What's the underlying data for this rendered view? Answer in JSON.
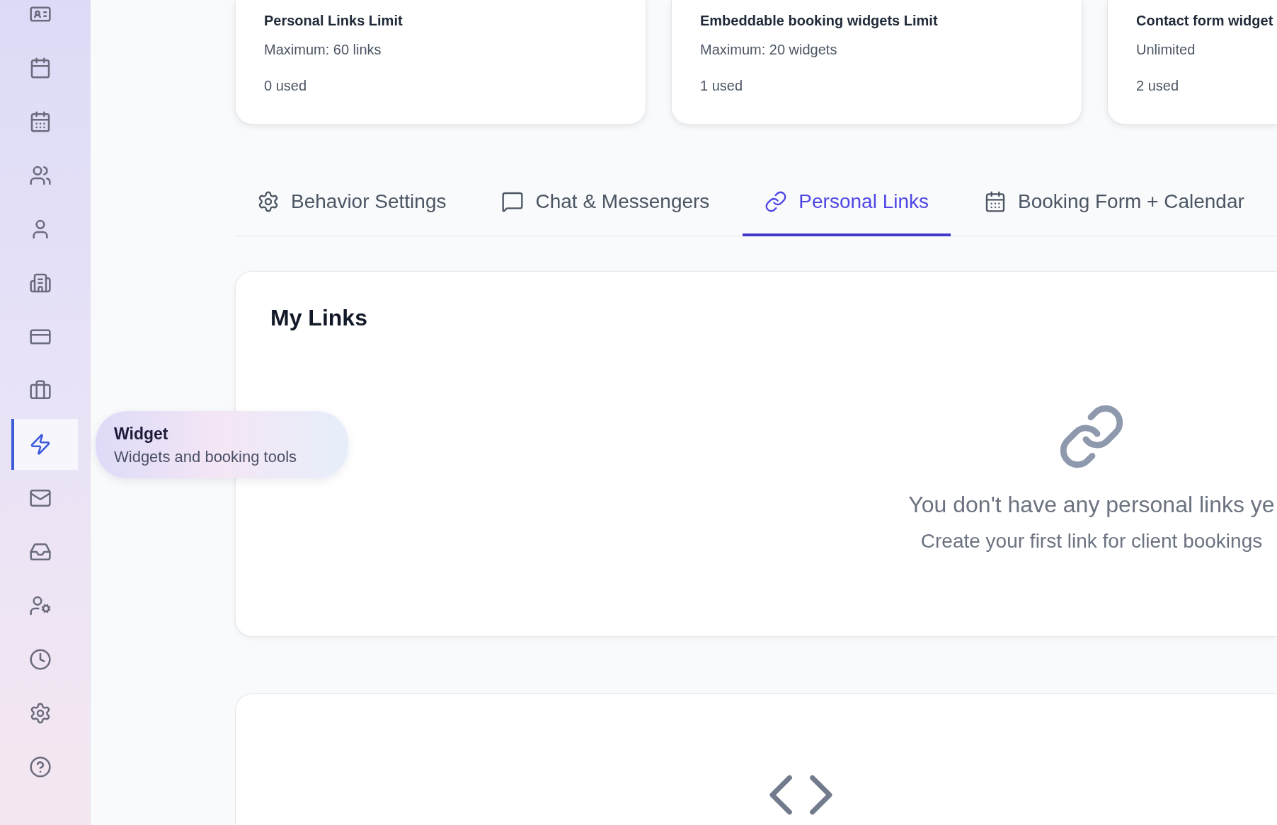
{
  "sidebar": {
    "items": [
      {
        "selected": false
      },
      {
        "selected": false
      },
      {
        "selected": false
      },
      {
        "selected": false
      },
      {
        "selected": false
      },
      {
        "selected": false
      },
      {
        "selected": false
      },
      {
        "selected": false
      },
      {
        "selected": true
      },
      {
        "selected": false
      },
      {
        "selected": false
      },
      {
        "selected": false
      },
      {
        "selected": false
      },
      {
        "selected": false
      },
      {
        "selected": false
      }
    ]
  },
  "tooltip": {
    "title": "Widget",
    "description": "Widgets and booking tools"
  },
  "limit_cards": [
    {
      "title": "Personal Links Limit",
      "maximum": "Maximum: 60 links",
      "used": "0 used"
    },
    {
      "title": "Embeddable booking widgets Limit",
      "maximum": "Maximum: 20 widgets",
      "used": "1 used"
    },
    {
      "title": "Contact form widget",
      "maximum": "Unlimited",
      "used": "2 used"
    }
  ],
  "tabs": [
    {
      "label": "Behavior Settings",
      "selected": false
    },
    {
      "label": "Chat & Messengers",
      "selected": false
    },
    {
      "label": "Personal Links",
      "selected": true
    },
    {
      "label": "Booking Form + Calendar",
      "selected": false
    }
  ],
  "my_links": {
    "title": "My Links",
    "empty_state": {
      "heading": "You don't have any personal links ye",
      "message": "Create your first link for client bookings"
    }
  }
}
